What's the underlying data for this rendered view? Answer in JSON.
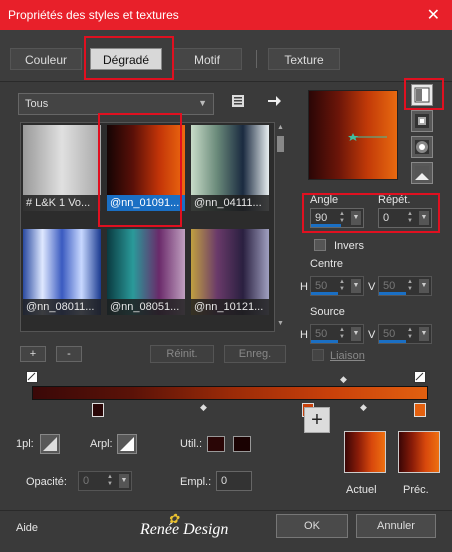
{
  "window": {
    "title": "Propriétés des styles et textures",
    "close_glyph": "✕"
  },
  "tabs": [
    {
      "label": "Couleur"
    },
    {
      "label": "Dégradé"
    },
    {
      "label": "Motif"
    },
    {
      "label": "Texture"
    }
  ],
  "category_select": {
    "value": "Tous"
  },
  "swatches": [
    {
      "caption": "# L&K 1 Vo...",
      "gradient": "linear-gradient(to right,#9a9a9a,#e0e0e0,#a8a8a8)"
    },
    {
      "caption": "@nn_01091...",
      "gradient": "linear-gradient(to right,#140404,#5a1008,#c23408,#ee6a10)"
    },
    {
      "caption": "@nn_04111...",
      "gradient": "linear-gradient(to right,#c8dcc8,#6a8a7a,#1a2a40,#e8eef0)"
    },
    {
      "caption": "@nn_08011...",
      "gradient": "linear-gradient(to right,#2a4aa0,#dfe8ff,#3a5ac0,#c8d8ff,#1a3a90)"
    },
    {
      "caption": "@nn_08051...",
      "gradient": "linear-gradient(to right,#0a3a40,#2a9a9a,#6a2a6a,#c0a0c0)"
    },
    {
      "caption": "@nn_10121...",
      "gradient": "linear-gradient(to right,#c0a040,#6a3a6a,#2a2040,#a0a0c0)"
    }
  ],
  "list_buttons": {
    "add": "+",
    "remove": "-",
    "reset": "Réinit.",
    "save": "Enreg."
  },
  "angle": {
    "label": "Angle",
    "value": "90"
  },
  "repeat": {
    "label": "Répét.",
    "value": "0"
  },
  "invert": {
    "label": "Invers"
  },
  "center": {
    "label": "Centre",
    "h_label": "H",
    "h_value": "50",
    "v_label": "V",
    "v_value": "50"
  },
  "source": {
    "label": "Source",
    "h_label": "H",
    "h_value": "50",
    "v_label": "V",
    "v_value": "50"
  },
  "link": {
    "label": "Liaison"
  },
  "stop_controls": {
    "position_label": "1pl:",
    "midpoint_label": "Arpl:",
    "use_label": "Util.:",
    "opacity_label": "Opacité:",
    "opacity_value": "0",
    "location_label": "Empl.:",
    "location_value": "0",
    "stop_color_1": "#2a0606",
    "stop_color_2": "#1a0202"
  },
  "current": {
    "label": "Actuel",
    "previous_label": "Préc."
  },
  "footer": {
    "help": "Aide",
    "ok": "OK",
    "cancel": "Annuler",
    "logo_text": "Renée Design"
  }
}
